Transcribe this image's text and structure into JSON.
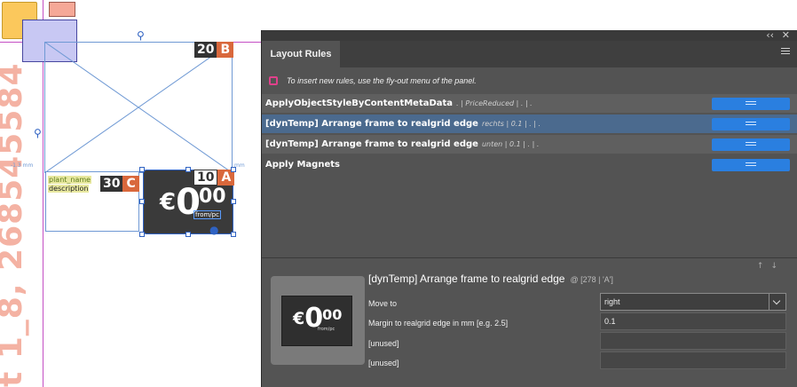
{
  "canvas": {
    "vertical_text": "t 1_8, 268545584",
    "tag_b": {
      "num": "20",
      "letter": "B"
    },
    "tag_c": {
      "num": "30",
      "letter": "C"
    },
    "tag_a": {
      "num": "10",
      "letter": "A"
    },
    "plant_name": "plant_name",
    "description": "description",
    "price": {
      "currency": "€",
      "whole": "0",
      "decimals": "00",
      "from": "from/pc"
    }
  },
  "panel": {
    "title": "Layout Rules",
    "info_text": "To insert new rules, use the fly-out menu of the panel.",
    "rules": [
      {
        "name": "ApplyObjectStyleByContentMetaData",
        "params": ". | PriceReduced | . | ."
      },
      {
        "name": "[dynTemp] Arrange frame to realgrid edge",
        "params": "rechts | 0.1 | . | ."
      },
      {
        "name": "[dynTemp] Arrange frame to realgrid edge",
        "params": "unten | 0.1 | . | ."
      },
      {
        "name": "Apply Magnets",
        "params": ""
      }
    ],
    "detail": {
      "title": "[dynTemp] Arrange frame to realgrid edge",
      "ref": "@ [278 | 'A']",
      "preview": {
        "currency": "€",
        "whole": "0",
        "decimals": "00",
        "from": "from/pc"
      },
      "fields": [
        {
          "label": "Move to",
          "value": "right"
        },
        {
          "label": "Margin to realgrid edge in mm [e.g. 2.5]",
          "value": "0.1"
        },
        {
          "label": "[unused]",
          "value": ""
        },
        {
          "label": "[unused]",
          "value": ""
        }
      ]
    }
  }
}
